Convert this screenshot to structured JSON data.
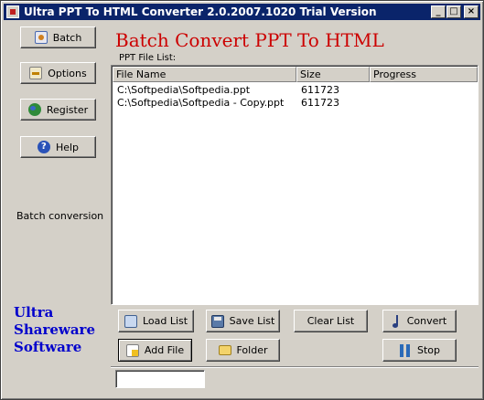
{
  "window": {
    "title": "Ultra PPT To HTML Converter 2.0.2007.1020 Trial Version"
  },
  "sidebar": {
    "buttons": [
      {
        "key": "batch",
        "label": "Batch",
        "icon": "batch-icon"
      },
      {
        "key": "options",
        "label": "Options",
        "icon": "options-icon"
      },
      {
        "key": "register",
        "label": "Register",
        "icon": "globe-icon"
      },
      {
        "key": "help",
        "label": "Help",
        "icon": "help-icon"
      }
    ],
    "caption": "Batch conversion",
    "brand": [
      "Ultra",
      "Shareware",
      "Software"
    ]
  },
  "main": {
    "title": "Batch Convert PPT To HTML",
    "list_caption": "PPT File List:",
    "columns": [
      "File Name",
      "Size",
      "Progress"
    ],
    "rows": [
      {
        "file": "C:\\Softpedia\\Softpedia.ppt",
        "size": "611723",
        "progress": ""
      },
      {
        "file": "C:\\Softpedia\\Softpedia - Copy.ppt",
        "size": "611723",
        "progress": ""
      }
    ]
  },
  "toolbar": {
    "load_list": "Load List",
    "save_list": "Save List",
    "clear_list": "Clear List",
    "convert": "Convert",
    "add_file": "Add File",
    "folder": "Folder",
    "stop": "Stop"
  },
  "status": {
    "value": ""
  },
  "colors": {
    "title_bar": "#0a246a",
    "heading": "#cc0000",
    "brand": "#0000cc",
    "face": "#d4d0c8"
  }
}
